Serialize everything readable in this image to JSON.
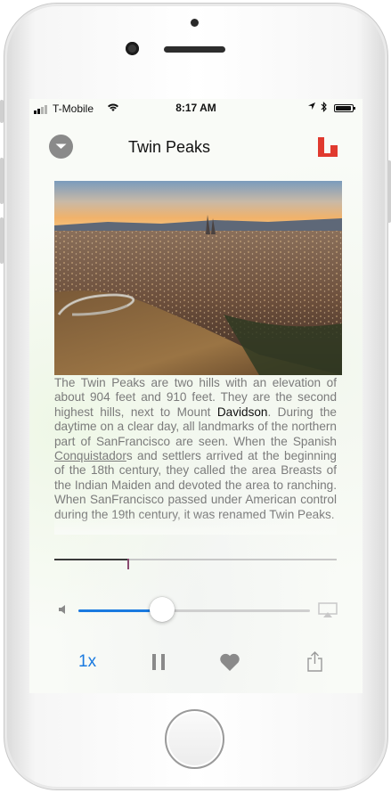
{
  "status_bar": {
    "carrier": "T-Mobile",
    "time": "8:17 AM",
    "signal_bars": 2,
    "battery_level": 0.95
  },
  "header": {
    "title": "Twin Peaks",
    "collapse_icon": "chevron-down-icon",
    "logo_icon": "app-logo-icon"
  },
  "article": {
    "image_icon": "san-francisco-photo",
    "text_parts": [
      {
        "t": "The Twin Peaks are two hills with an elevation of about 904 feet and 910 feet. They are the second highest hills, next to Mount ",
        "s": ""
      },
      {
        "t": "Davidson",
        "s": "hl"
      },
      {
        "t": ". During the daytime on a clear day, all landmarks of the northern part of SanFrancisco are seen. When the Spanish ",
        "s": ""
      },
      {
        "t": "Conquistador",
        "s": "ul"
      },
      {
        "t": "s and settlers arrived at the beginning of the 18th century, they called the area Breasts of the Indian Maiden and devoted the area to ranching. When SanFrancisco passed under American control during the 19th century, it was renamed Twin Peaks.",
        "s": ""
      }
    ]
  },
  "player": {
    "progress_fraction": 0.26,
    "volume_fraction": 0.36,
    "speed_label": "1x",
    "pause_icon": "pause-icon",
    "favorite_icon": "heart-icon",
    "share_icon": "share-icon",
    "volume_icon": "speaker-icon",
    "airplay_icon": "airplay-icon"
  },
  "colors": {
    "accent": "#1a7ae0",
    "logo_red": "#e03a2f",
    "muted_text": "#7b7b7b"
  }
}
